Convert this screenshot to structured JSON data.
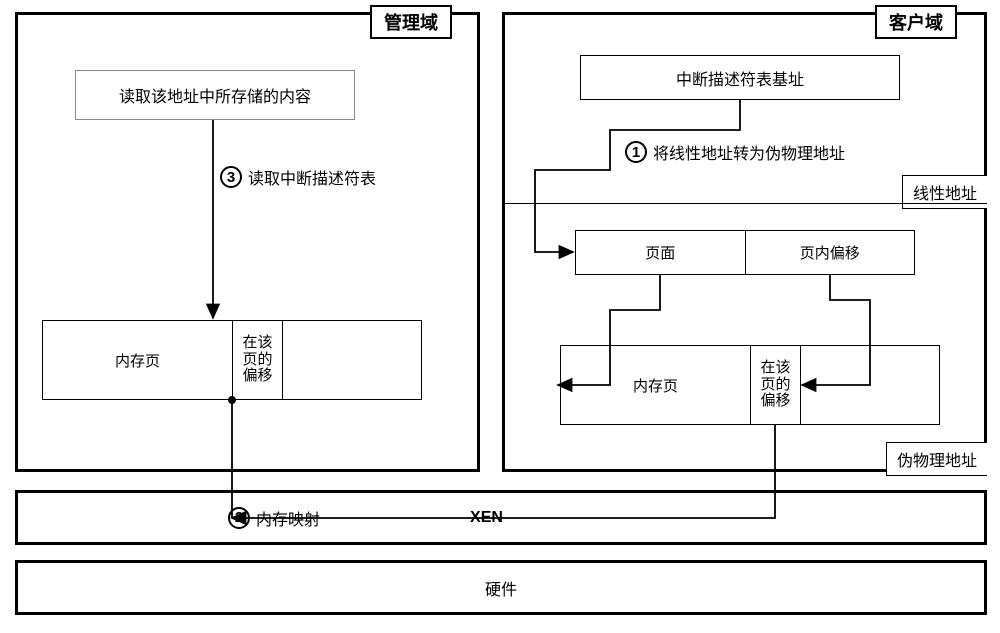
{
  "management_domain": {
    "tab": "管理域",
    "read_content": "读取该地址中所存储的内容",
    "step3": "读取中断描述符表",
    "mem_page": "内存页",
    "page_offset": "在该页的偏移"
  },
  "client_domain": {
    "tab": "客户域",
    "idt_base": "中断描述符表基址",
    "step1": "将线性地址转为伪物理地址",
    "linear_addr": "线性地址",
    "page": "页面",
    "in_page_offset": "页内偏移",
    "mem_page": "内存页",
    "page_offset": "在该页的偏移",
    "pseudo_phys": "伪物理地址"
  },
  "xen": {
    "step2": "内存映射",
    "label": "XEN"
  },
  "hardware": "硬件",
  "nums": {
    "one": "1",
    "two": "2",
    "three": "3"
  }
}
